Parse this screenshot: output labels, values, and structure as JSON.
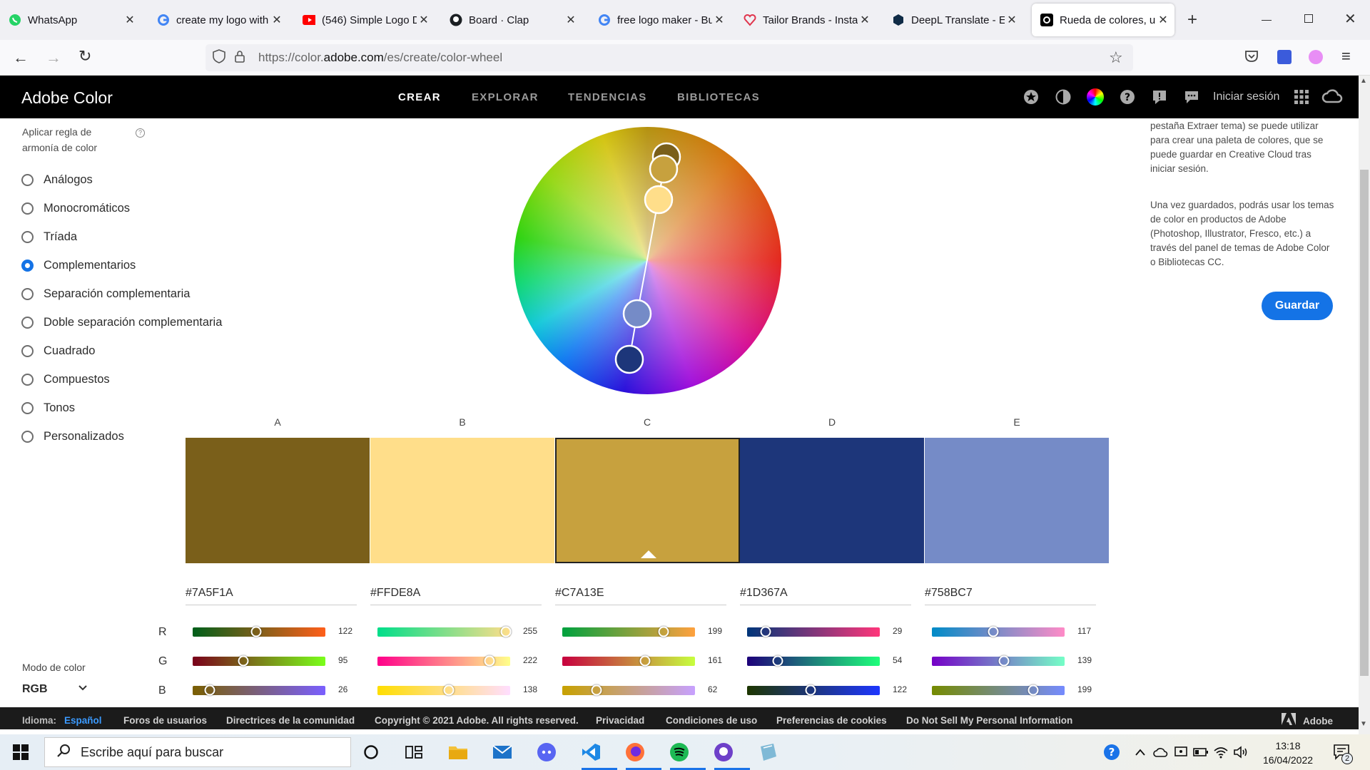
{
  "browser": {
    "tabs": [
      {
        "label": "WhatsApp",
        "icon": "whatsapp-icon"
      },
      {
        "label": "create my logo with",
        "icon": "google-icon"
      },
      {
        "label": "(546) Simple Logo D",
        "icon": "youtube-icon"
      },
      {
        "label": "Board · Clap",
        "icon": "github-icon"
      },
      {
        "label": "free logo maker - Bu",
        "icon": "google-icon"
      },
      {
        "label": "Tailor Brands - Instar",
        "icon": "tailorbrands-icon"
      },
      {
        "label": "DeepL Translate - El",
        "icon": "deepl-icon"
      },
      {
        "label": "Rueda de colores, ur",
        "icon": "adobe-color-icon"
      }
    ],
    "url_prefix": "https://color.",
    "url_domain": "adobe.com",
    "url_path": "/es/create/color-wheel"
  },
  "app": {
    "logo": "Adobe Color",
    "nav": [
      "CREAR",
      "EXPLORAR",
      "TENDENCIAS",
      "BIBLIOTECAS"
    ],
    "signin": "Iniciar sesión"
  },
  "harmony": {
    "title": "Aplicar regla de armonía de color",
    "options": [
      "Análogos",
      "Monocromáticos",
      "Tríada",
      "Complementarios",
      "Separación complementaria",
      "Doble separación complementaria",
      "Cuadrado",
      "Compuestos",
      "Tonos",
      "Personalizados"
    ],
    "selected": "Complementarios"
  },
  "right_panel": {
    "text1": "pestaña Extraer tema) se puede utilizar para crear una paleta de colores, que se puede guardar en Creative Cloud tras iniciar sesión.",
    "text2": "Una vez guardados, podrás usar los temas de color en productos de Adobe (Photoshop, Illustrator, Fresco, etc.) a través del panel de temas de Adobe Color o Bibliotecas CC.",
    "save_label": "Guardar"
  },
  "swatches": [
    {
      "label": "A",
      "hex": "#7A5F1A",
      "r": 122,
      "g": 95,
      "b": 26
    },
    {
      "label": "B",
      "hex": "#FFDE8A",
      "r": 255,
      "g": 222,
      "b": 138
    },
    {
      "label": "C",
      "hex": "#C7A13E",
      "r": 199,
      "g": 161,
      "b": 62
    },
    {
      "label": "D",
      "hex": "#1D367A",
      "r": 29,
      "g": 54,
      "b": 122
    },
    {
      "label": "E",
      "hex": "#758BC7",
      "r": 117,
      "g": 139,
      "b": 199
    }
  ],
  "selected_swatch": "C",
  "channels": [
    "R",
    "G",
    "B"
  ],
  "color_mode": {
    "label": "Modo de color",
    "value": "RGB"
  },
  "footer": {
    "lang_label": "Idioma:",
    "lang_value": "Español",
    "links": [
      "Foros de usuarios",
      "Directrices de la comunidad",
      "Copyright © 2021 Adobe. All rights reserved.",
      "Privacidad",
      "Condiciones de uso",
      "Preferencias de cookies",
      "Do Not Sell My Personal Information"
    ],
    "brand": "Adobe"
  },
  "taskbar": {
    "search_placeholder": "Escribe aquí para buscar",
    "time": "13:18",
    "date": "16/04/2022",
    "notification_count": "2"
  },
  "colors": {
    "accent": "#1473e6",
    "header_bg": "#000000"
  }
}
